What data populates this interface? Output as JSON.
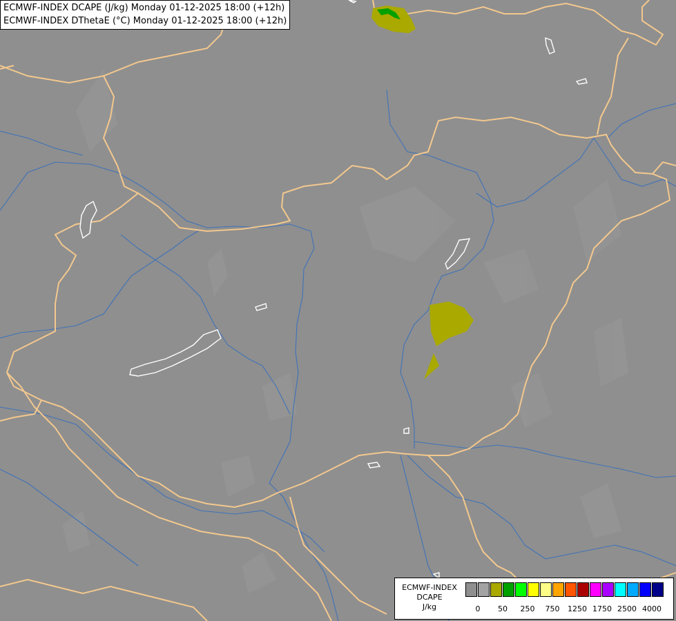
{
  "titles": [
    "ECMWF-INDEX DCAPE (J/kg) Monday 01-12-2025 18:00 (+12h)",
    "ECMWF-INDEX DThetaE (°C) Monday 01-12-2025 18:00 (+12h)"
  ],
  "legend": {
    "line1": "ECMWF-INDEX",
    "line2": "DCAPE",
    "line3": "J/kg",
    "colors": [
      "#8f8f8f",
      "#a3a3a3",
      "#a9a900",
      "#00a000",
      "#00ff00",
      "#ffff00",
      "#ffff88",
      "#ffa500",
      "#ff5500",
      "#aa0000",
      "#ff00ff",
      "#aa00ff",
      "#00ffff",
      "#00aaff",
      "#0000ff",
      "#000088"
    ],
    "ticks": [
      "0",
      "50",
      "250",
      "750",
      "1250",
      "1750",
      "2500",
      "4000"
    ]
  },
  "map": {
    "background": "#8f8f8f",
    "border_color": "#f3c88e",
    "river_color": "#3f72b8",
    "lake_color": "#ffffff",
    "dcape_low_color": "#a9a900",
    "dcape_mid_color": "#00a000"
  }
}
